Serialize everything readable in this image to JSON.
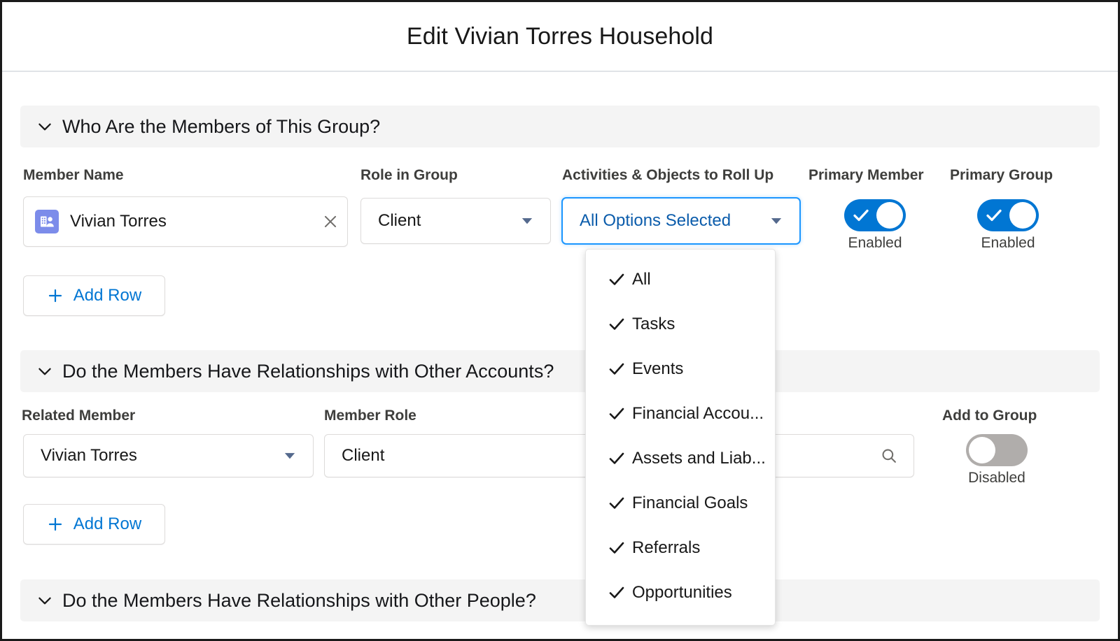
{
  "header": {
    "title": "Edit Vivian Torres Household"
  },
  "colors": {
    "accent_blue": "#0176d3",
    "link_blue": "#0b5cab",
    "toggle_on": "#0176d3",
    "toggle_off": "#b0adab",
    "account_icon": "#7c8cea",
    "band_gray": "#f4f4f4"
  },
  "sections": [
    {
      "title": "Who Are the Members of This Group?",
      "chevron": "chevron-down-icon",
      "columns": [
        "Member Name",
        "Role in Group",
        "Activities & Objects to Roll Up",
        "Primary Member",
        "Primary Group"
      ],
      "row": {
        "member_name": "Vivian Torres",
        "member_icon": "account-person-icon",
        "clear_icon": "close-icon",
        "role_in_group": "Client",
        "activities": "All Options Selected",
        "primary_member": {
          "state": "Enabled",
          "on": true
        },
        "primary_group": {
          "state": "Enabled",
          "on": true
        }
      },
      "add_row_label": "Add Row"
    },
    {
      "title": "Do the Members Have Relationships with Other Accounts?",
      "chevron": "chevron-down-icon",
      "columns": [
        "Related Member",
        "Member Role",
        "Add to Group"
      ],
      "row": {
        "related_member": "Vivian Torres",
        "member_role": "Client",
        "search_placeholder": "...",
        "search_icon": "search-icon",
        "add_to_group": {
          "state": "Disabled",
          "on": false
        }
      },
      "add_row_label": "Add Row"
    },
    {
      "title": "Do the Members Have Relationships with Other People?",
      "chevron": "chevron-down-icon"
    }
  ],
  "dropdown": {
    "open": true,
    "items": [
      {
        "label": "All",
        "checked": true
      },
      {
        "label": "Tasks",
        "checked": true
      },
      {
        "label": "Events",
        "checked": true
      },
      {
        "label": "Financial Accou...",
        "checked": true
      },
      {
        "label": "Assets and Liab...",
        "checked": true
      },
      {
        "label": "Financial Goals",
        "checked": true
      },
      {
        "label": "Referrals",
        "checked": true
      },
      {
        "label": "Opportunities",
        "checked": true
      }
    ]
  }
}
